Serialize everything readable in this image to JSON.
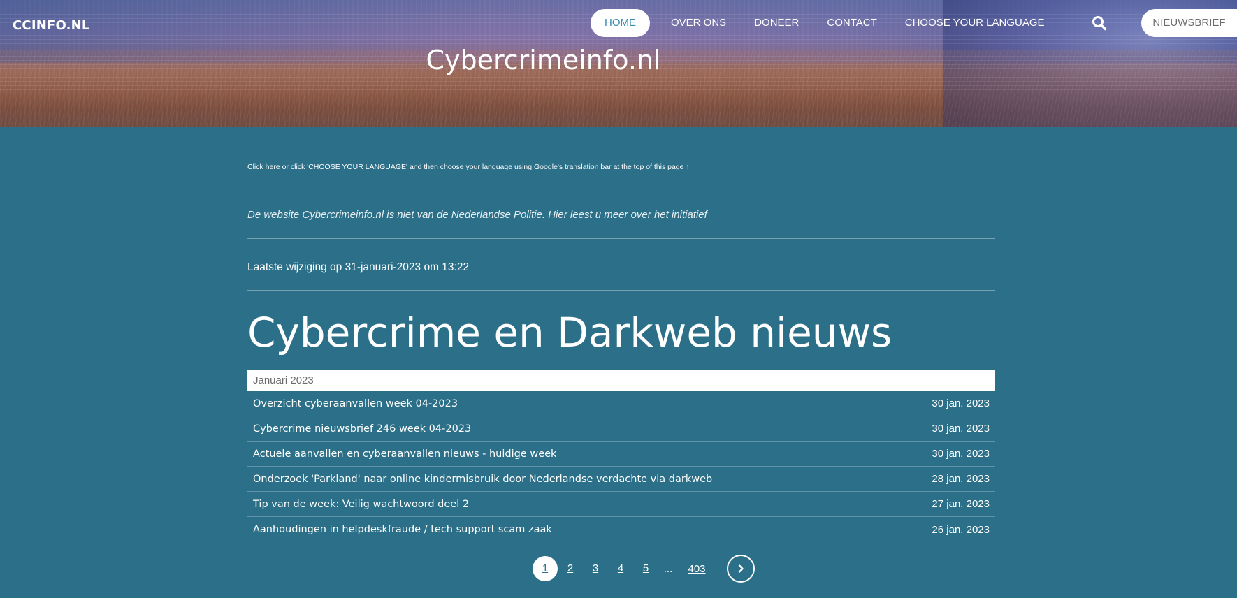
{
  "header": {
    "brand": "CCINFO.NL",
    "site_title": "Cybercrimeinfo.nl",
    "nav": [
      {
        "label": "HOME",
        "active": true
      },
      {
        "label": "OVER ONS",
        "active": false
      },
      {
        "label": "DONEER",
        "active": false
      },
      {
        "label": "CONTACT",
        "active": false
      },
      {
        "label": "CHOOSE YOUR LANGUAGE",
        "active": false
      }
    ],
    "search_icon": "search-icon",
    "newsletter_label": "NIEUWSBRIEF"
  },
  "intro": {
    "translate_prefix": "Click ",
    "translate_link": "here",
    "translate_suffix": " or click 'CHOOSE YOUR LANGUAGE' and then choose your language using Google's translation bar at the top of this page ↑",
    "disclaimer_text": "De website Cybercrimeinfo.nl is niet van de Nederlandse Politie. ",
    "disclaimer_link": "Hier leest u meer over het initiatief",
    "last_modified": "Laatste wijziging op 31-januari-2023 om 13:22"
  },
  "news": {
    "heading": "Cybercrime en Darkweb nieuws",
    "month": "Januari 2023",
    "items": [
      {
        "title": "Overzicht cyberaanvallen week 04-2023",
        "date": "30 jan. 2023"
      },
      {
        "title": "Cybercrime nieuwsbrief 246 week 04-2023",
        "date": "30 jan. 2023"
      },
      {
        "title": "Actuele aanvallen en cyberaanvallen nieuws - huidige week",
        "date": "30 jan. 2023"
      },
      {
        "title": "Onderzoek 'Parkland' naar online kindermisbruik door Nederlandse verdachte via darkweb",
        "date": "28 jan. 2023"
      },
      {
        "title": "Tip van de week: Veilig wachtwoord deel 2",
        "date": "27 jan. 2023"
      },
      {
        "title": "Aanhoudingen in helpdeskfraude / tech support scam zaak",
        "date": "26 jan. 2023"
      }
    ]
  },
  "pagination": {
    "pages": [
      "1",
      "2",
      "3",
      "4",
      "5"
    ],
    "current": "1",
    "ellipsis": "...",
    "last": "403",
    "next_icon": "chevron-right-icon"
  },
  "colors": {
    "background": "#2b6f88",
    "active_nav_text": "#3a8db0"
  }
}
